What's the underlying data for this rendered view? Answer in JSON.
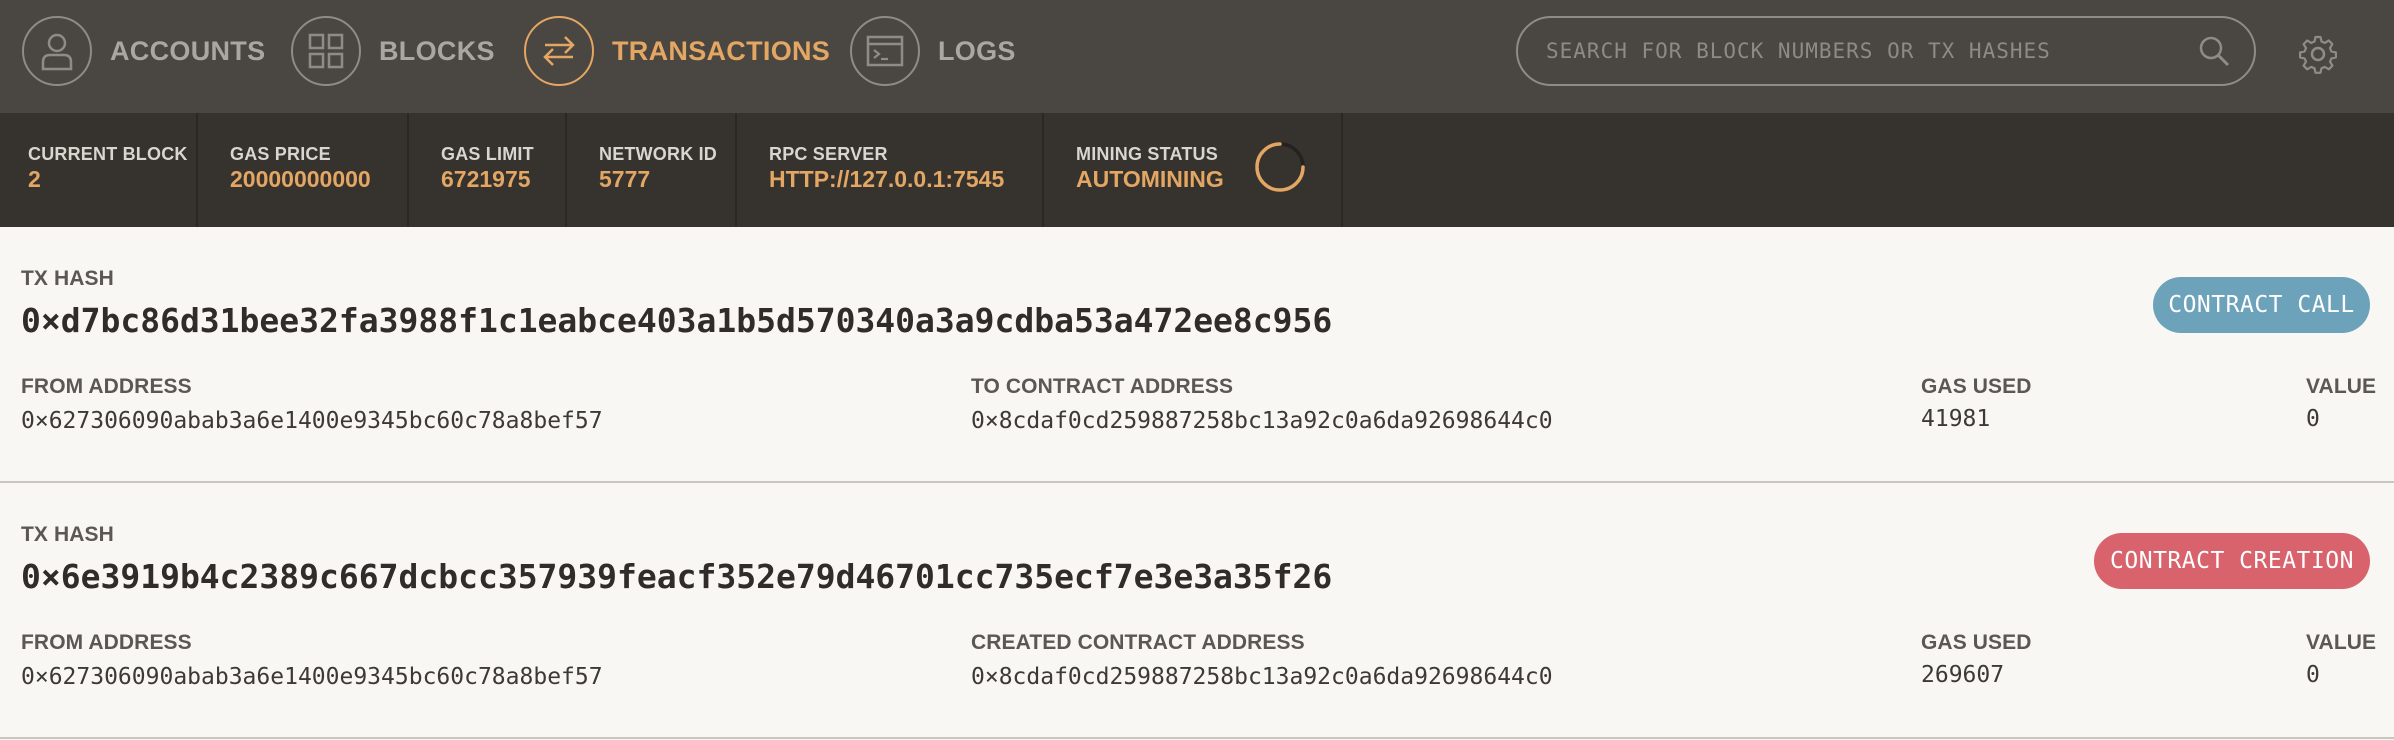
{
  "nav": {
    "items": [
      {
        "label": "ACCOUNTS",
        "icon": "user-icon",
        "active": false
      },
      {
        "label": "BLOCKS",
        "icon": "grid-icon",
        "active": false
      },
      {
        "label": "TRANSACTIONS",
        "icon": "swap-arrows-icon",
        "active": true
      },
      {
        "label": "LOGS",
        "icon": "terminal-icon",
        "active": false
      }
    ],
    "search_placeholder": "SEARCH FOR BLOCK NUMBERS OR TX HASHES"
  },
  "status": [
    {
      "label": "CURRENT BLOCK",
      "value": "2"
    },
    {
      "label": "GAS PRICE",
      "value": "20000000000"
    },
    {
      "label": "GAS LIMIT",
      "value": "6721975"
    },
    {
      "label": "NETWORK ID",
      "value": "5777"
    },
    {
      "label": "RPC SERVER",
      "value": "HTTP://127.0.0.1:7545"
    },
    {
      "label": "MINING STATUS",
      "value": "AUTOMINING"
    }
  ],
  "transactions": [
    {
      "hash_label": "TX HASH",
      "hash": "0×d7bc86d31bee32fa3988f1c1eabce403a1b5d570340a3a9cdba53a472ee8c956",
      "type": "CONTRACT CALL",
      "type_color": "#6ca3bb",
      "from_label": "FROM ADDRESS",
      "from": "0×627306090abab3a6e1400e9345bc60c78a8bef57",
      "to_label": "TO CONTRACT ADDRESS",
      "to": "0×8cdaf0cd259887258bc13a92c0a6da92698644c0",
      "gas_label": "GAS USED",
      "gas": "41981",
      "value_label": "VALUE",
      "value": "0"
    },
    {
      "hash_label": "TX HASH",
      "hash": "0×6e3919b4c2389c667dcbcc357939feacf352e79d46701cc735ecf7e3e3a35f26",
      "type": "CONTRACT CREATION",
      "type_color": "#d8636c",
      "from_label": "FROM ADDRESS",
      "from": "0×627306090abab3a6e1400e9345bc60c78a8bef57",
      "to_label": "CREATED CONTRACT ADDRESS",
      "to": "0×8cdaf0cd259887258bc13a92c0a6da92698644c0",
      "gas_label": "GAS USED",
      "gas": "269607",
      "value_label": "VALUE",
      "value": "0"
    }
  ],
  "colors": {
    "accent": "#e4a663",
    "nav_bg": "#4a4743",
    "status_bg": "#36332f",
    "content_bg": "#f8f7f3"
  }
}
